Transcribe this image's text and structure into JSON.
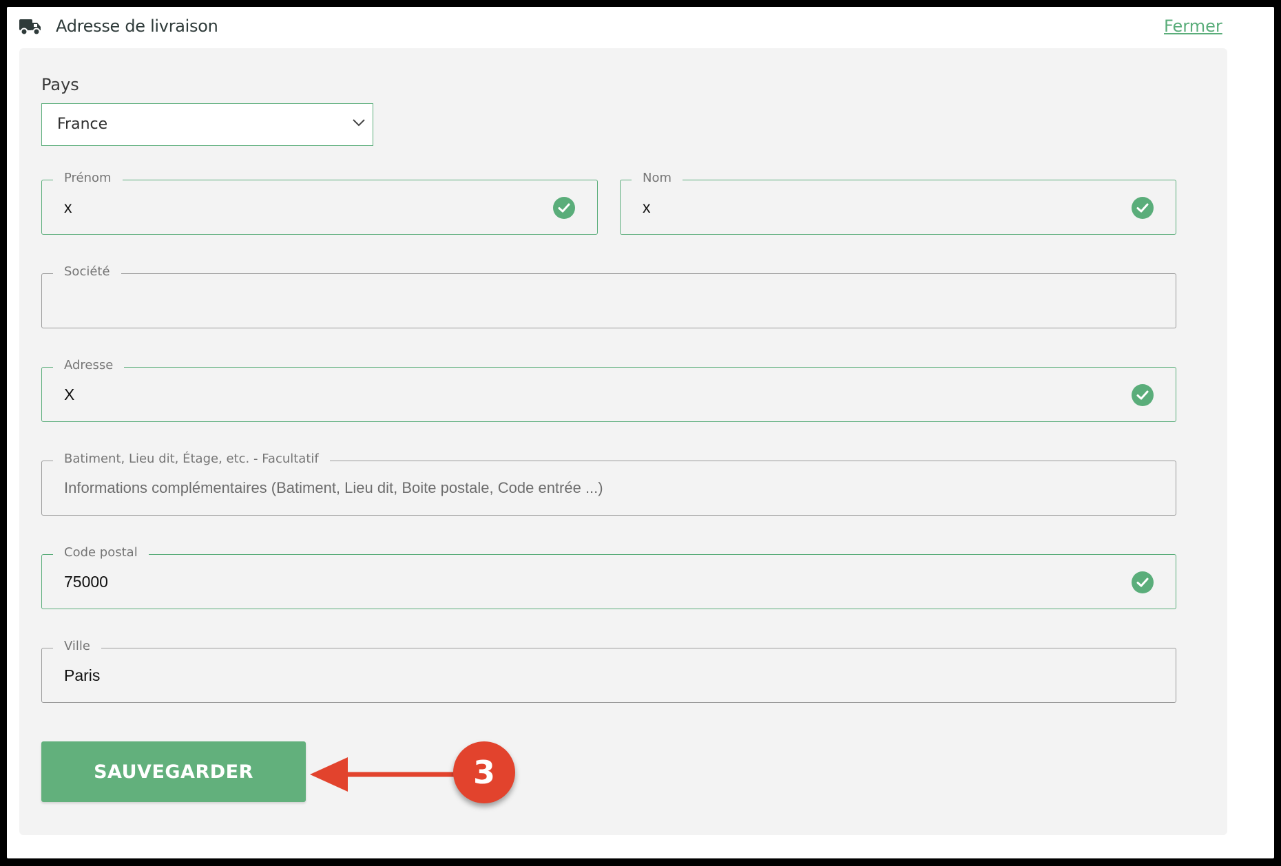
{
  "header": {
    "icon": "truck-icon",
    "title": "Adresse de livraison",
    "close_label": "Fermer"
  },
  "colors": {
    "accent_green": "#5aad7a",
    "button_green": "#62b07c",
    "annotation_red": "#e2432d",
    "panel_bg": "#f3f3f3"
  },
  "country": {
    "label": "Pays",
    "selected": "France"
  },
  "fields": {
    "first_name": {
      "label": "Prénom",
      "value": "x",
      "valid": true
    },
    "last_name": {
      "label": "Nom",
      "value": "x",
      "valid": true
    },
    "company": {
      "label": "Société",
      "value": ""
    },
    "address": {
      "label": "Adresse",
      "value": "X",
      "valid": true
    },
    "address2": {
      "label": "Batiment, Lieu dit, Étage, etc. - Facultatif",
      "placeholder": "Informations complémentaires (Batiment, Lieu dit, Boite postale, Code entrée ...)"
    },
    "postal_code": {
      "label": "Code postal",
      "value": "75000",
      "valid": true
    },
    "city": {
      "label": "Ville",
      "value": "Paris"
    }
  },
  "actions": {
    "save_label": "SAUVEGARDER"
  },
  "annotation": {
    "step_number": "3"
  }
}
